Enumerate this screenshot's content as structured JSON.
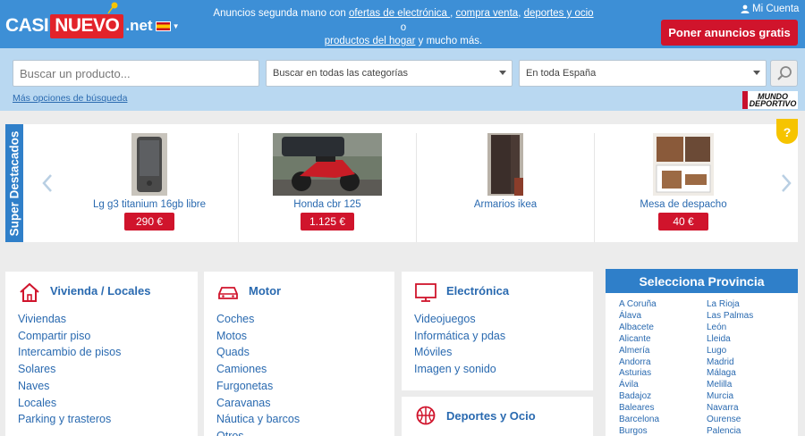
{
  "header": {
    "logo": {
      "part1": "CASI",
      "part2": "NUEVO",
      "part3": ".net"
    },
    "tagline": {
      "t1": "Anuncios segunda mano con ",
      "link1": "ofertas de electrónica ",
      "t2": ", ",
      "link2": "compra venta",
      "t3": ", ",
      "link3": "deportes y ocio",
      "t4": " o ",
      "link4": "productos del hogar",
      "t5": " y mucho más."
    },
    "account_label": "Mi Cuenta",
    "post_button": "Poner anuncios gratis"
  },
  "search": {
    "placeholder": "Buscar un producto...",
    "category_value": "Buscar en todas las categorías",
    "location_value": "En toda España",
    "more_options": "Más opciones de búsqueda",
    "partner_logo": "MUNDO DEPORTIVO"
  },
  "featured": {
    "tab_label": "Super Destacados",
    "items": [
      {
        "title": "Lg g3 titanium 16gb libre",
        "price": "290 €"
      },
      {
        "title": "Honda cbr 125",
        "price": "1.125 €"
      },
      {
        "title": "Armarios ikea",
        "price": ""
      },
      {
        "title": "Mesa de despacho",
        "price": "40 €"
      }
    ],
    "help_badge": "?"
  },
  "categories": {
    "vivienda": {
      "title": "Vivienda / Locales",
      "items": [
        "Viviendas",
        "Compartir piso",
        "Intercambio de pisos",
        "Solares",
        "Naves",
        "Locales",
        "Parking y trasteros"
      ]
    },
    "motor": {
      "title": "Motor",
      "items": [
        "Coches",
        "Motos",
        "Quads",
        "Camiones",
        "Furgonetas",
        "Caravanas",
        "Náutica y barcos",
        "Otros"
      ]
    },
    "electronica": {
      "title": "Electrónica",
      "items": [
        "Videojuegos",
        "Informática y pdas",
        "Móviles",
        "Imagen y sonido"
      ]
    },
    "deportes": {
      "title": "Deportes y Ocio"
    }
  },
  "provinces": {
    "title": "Selecciona Provincia",
    "col1": [
      "A Coruña",
      "Álava",
      "Albacete",
      "Alicante",
      "Almería",
      "Andorra",
      "Asturias",
      "Ávila",
      "Badajoz",
      "Baleares",
      "Barcelona",
      "Burgos"
    ],
    "col2": [
      "La Rioja",
      "Las Palmas",
      "León",
      "Lleida",
      "Lugo",
      "Madrid",
      "Málaga",
      "Melilla",
      "Murcia",
      "Navarra",
      "Ourense",
      "Palencia"
    ]
  },
  "colors": {
    "header_blue": "#3d8fd6",
    "search_band": "#b9d8f1",
    "accent_red": "#d0142c",
    "link_blue": "#2a6ab0"
  }
}
